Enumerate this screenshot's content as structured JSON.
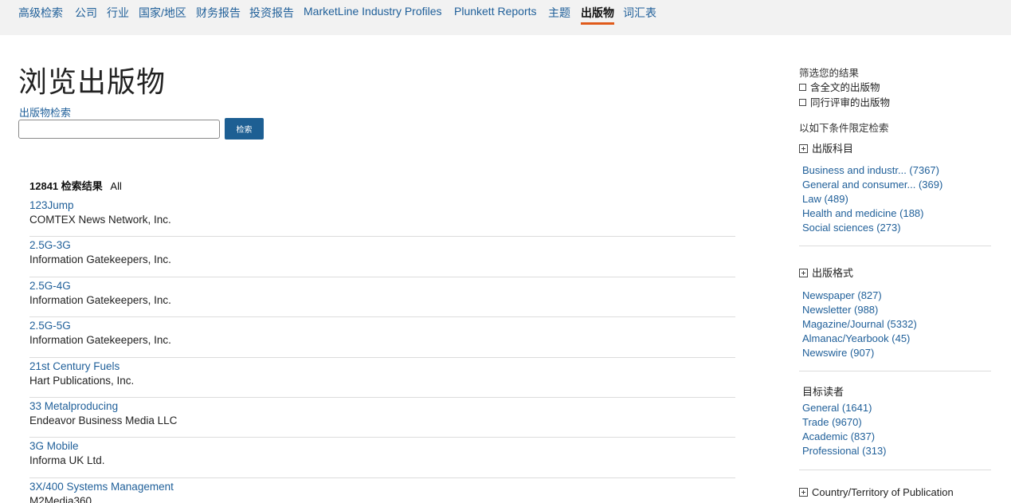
{
  "nav": {
    "items": [
      {
        "label": "高级检索"
      },
      {
        "label": "公司"
      },
      {
        "label": "行业"
      },
      {
        "label": "国家/地区"
      },
      {
        "label": "财务报告"
      },
      {
        "label": "投资报告"
      },
      {
        "label": "MarketLine Industry Profiles"
      },
      {
        "label": "Plunkett Reports"
      },
      {
        "label": "主题"
      },
      {
        "label": "出版物",
        "active": true
      },
      {
        "label": "词汇表"
      }
    ]
  },
  "page": {
    "title": "浏览出版物",
    "search_label": "出版物检索",
    "search_value": "",
    "search_button": "检索"
  },
  "results": {
    "count": "12841",
    "count_label": "检索结果",
    "filter": "All",
    "items": [
      {
        "title": "123Jump",
        "publisher": "COMTEX News Network, Inc."
      },
      {
        "title": "2.5G-3G",
        "publisher": "Information Gatekeepers, Inc."
      },
      {
        "title": "2.5G-4G",
        "publisher": "Information Gatekeepers, Inc."
      },
      {
        "title": "2.5G-5G",
        "publisher": "Information Gatekeepers, Inc."
      },
      {
        "title": "21st Century Fuels",
        "publisher": "Hart Publications, Inc."
      },
      {
        "title": "33 Metalproducing",
        "publisher": "Endeavor Business Media LLC"
      },
      {
        "title": "3G Mobile",
        "publisher": "Informa UK Ltd."
      },
      {
        "title": "3X/400 Systems Management",
        "publisher": "M2Media360"
      }
    ]
  },
  "sidebar": {
    "refine_heading": "筛选您的结果",
    "full_text": "含全文的出版物",
    "peer_reviewed": "同行评审的出版物",
    "limit_heading": "以如下条件限定检索",
    "subject": {
      "title": "出版科目",
      "links": [
        "Business and industr... (7367)",
        "General and consumer... (369)",
        "Law (489)",
        "Health and medicine (188)",
        "Social sciences (273)"
      ]
    },
    "format": {
      "title": "出版格式",
      "links": [
        "Newspaper (827)",
        "Newsletter (988)",
        "Magazine/Journal (5332)",
        "Almanac/Yearbook (45)",
        "Newswire (907)"
      ]
    },
    "audience": {
      "title": "目标读者",
      "links": [
        "General (1641)",
        "Trade (9670)",
        "Academic (837)",
        "Professional (313)"
      ]
    },
    "country": {
      "title": "Country/Territory of Publication"
    }
  }
}
